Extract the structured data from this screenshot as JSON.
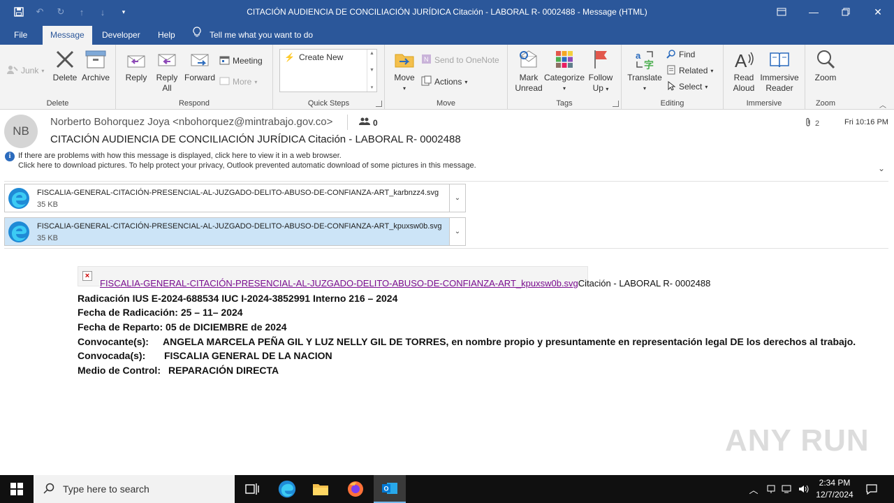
{
  "window": {
    "title": "CITACIÓN AUDIENCIA DE CONCILIACIÓN JURÍDICA Citación - LABORAL R- 0002488  -  Message (HTML)"
  },
  "menu": {
    "tabs": [
      "File",
      "Message",
      "Developer",
      "Help"
    ],
    "tell_me": "Tell me what you want to do"
  },
  "ribbon": {
    "junk": "Junk",
    "delete": "Delete",
    "archive": "Archive",
    "group_delete": "Delete",
    "reply": "Reply",
    "reply_all_1": "Reply",
    "reply_all_2": "All",
    "forward": "Forward",
    "meeting": "Meeting",
    "more": "More",
    "group_respond": "Respond",
    "create_new": "Create New",
    "group_quick_steps": "Quick Steps",
    "move": "Move",
    "send_onenote": "Send to OneNote",
    "actions": "Actions",
    "group_move": "Move",
    "mark_unread_1": "Mark",
    "mark_unread_2": "Unread",
    "categorize": "Categorize",
    "follow_up_1": "Follow",
    "follow_up_2": "Up",
    "group_tags": "Tags",
    "translate": "Translate",
    "find": "Find",
    "related": "Related",
    "select": "Select",
    "group_editing": "Editing",
    "read_aloud_1": "Read",
    "read_aloud_2": "Aloud",
    "immersive_1": "Immersive",
    "immersive_2": "Reader",
    "group_immersive": "Immersive",
    "zoom": "Zoom",
    "group_zoom": "Zoom"
  },
  "message": {
    "avatar_initials": "NB",
    "from": "Norberto Bohorquez Joya <nbohorquez@mintrabajo.gov.co>",
    "people_count": "0",
    "subject": "CITACIÓN AUDIENCIA DE CONCILIACIÓN JURÍDICA Citación - LABORAL R- 0002488",
    "attachment_count": "2",
    "time": "Fri 10:16 PM",
    "info_line1": "If there are problems with how this message is displayed, click here to view it in a web browser.",
    "info_line2": "Click here to download pictures. To help protect your privacy, Outlook prevented automatic download of some pictures in this message."
  },
  "attachments": [
    {
      "name": "FISCALIA-GENERAL-CITACIÓN-PRESENCIAL-AL-JUZGADO-DELITO-ABUSO-DE-CONFIANZA-ART_karbnzz4.svg",
      "size": "35 KB"
    },
    {
      "name": "FISCALIA-GENERAL-CITACIÓN-PRESENCIAL-AL-JUZGADO-DELITO-ABUSO-DE-CONFIANZA-ART_kpuxsw0b.svg",
      "size": "35 KB"
    }
  ],
  "body": {
    "link": "FISCALIA-GENERAL-CITACIÓN-PRESENCIAL-AL-JUZGADO-DELITO-ABUSO-DE-CONFIANZA-ART_kpuxsw0b.svg",
    "link_suffix": "Citación - LABORAL R- 0002488",
    "radicacion": "Radicación IUS E-2024-688534 IUC I-2024-3852991  Interno 216 – 2024",
    "fecha_radicacion": "Fecha de Radicación: 25 – 11– 2024",
    "fecha_reparto": "Fecha de Reparto: 05 de DICIEMBRE de 2024",
    "convocante_label": "Convocante(s):",
    "convocante_value": "ANGELA MARCELA PEÑA GIL Y LUZ NELLY GIL DE TORRES, en nombre propio y presuntamente en representación legal DE los derechos al trabajo.",
    "convocada_label": "Convocada(s):",
    "convocada_value": "FISCALIA GENERAL DE LA NACION",
    "medio_label": "Medio de Control:",
    "medio_value": "REPARACIÓN DIRECTA"
  },
  "watermark": "ANY RUN",
  "taskbar": {
    "search_placeholder": "Type here to search",
    "time": "2:34 PM",
    "date": "12/7/2024"
  },
  "colors": {
    "accent": "#2b579a",
    "ribbon_bg": "#f3f3f3",
    "selected_attachment": "#cce4f7",
    "link": "#7a0e8f"
  }
}
